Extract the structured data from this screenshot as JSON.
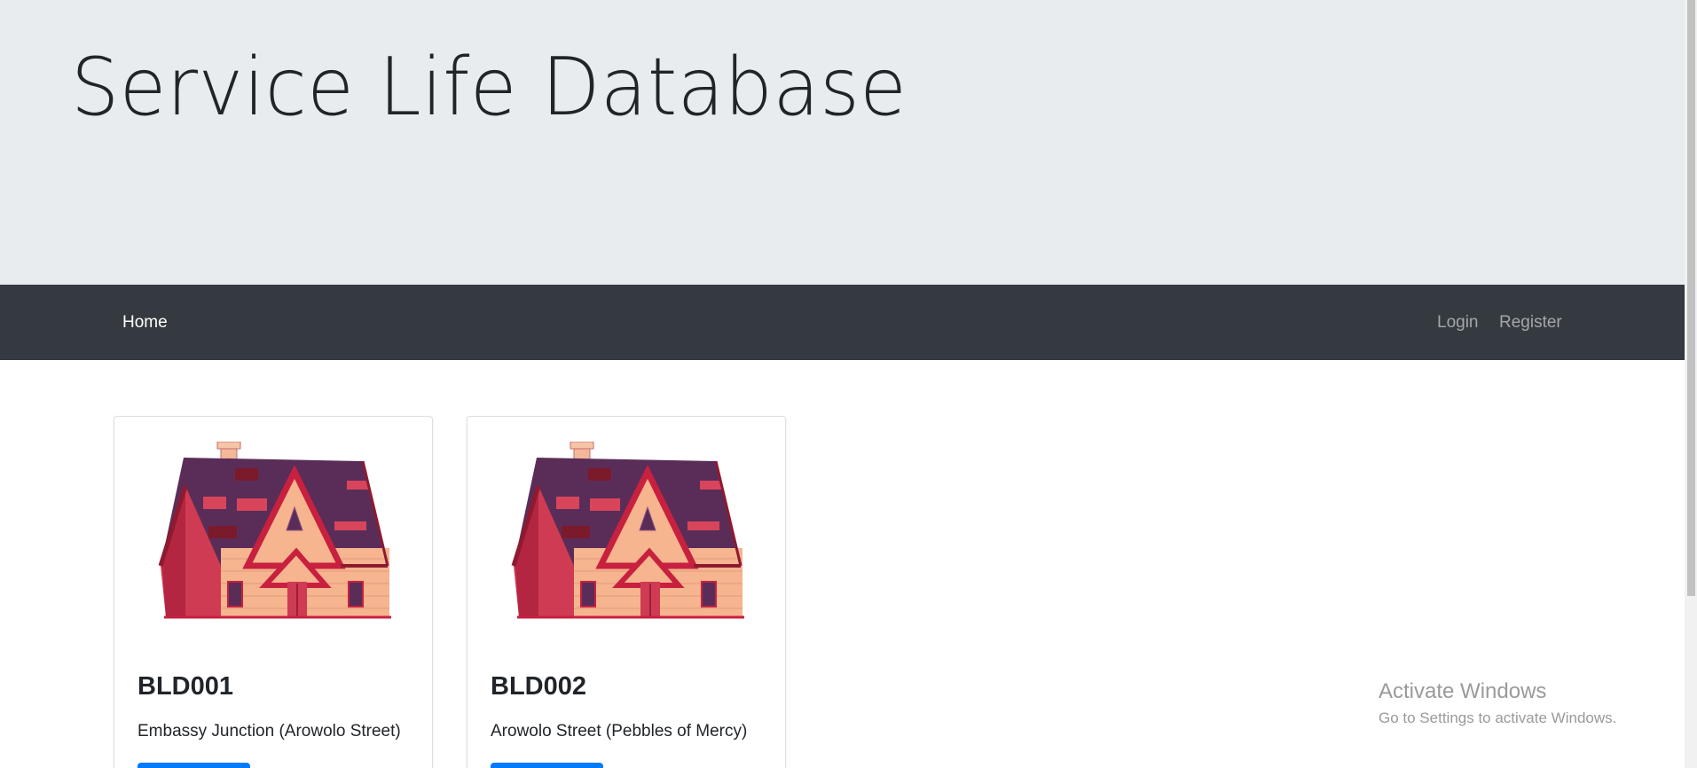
{
  "header": {
    "title": "Service Life Database"
  },
  "nav": {
    "home": "Home",
    "login": "Login",
    "register": "Register"
  },
  "cards": [
    {
      "id": "BLD001",
      "location": "Embassy Junction (Arowolo Street)",
      "image_icon": "house-illustration"
    },
    {
      "id": "BLD002",
      "location": "Arowolo Street (Pebbles of Mercy)",
      "image_icon": "house-illustration"
    }
  ],
  "watermark": {
    "title": "Activate Windows",
    "subtitle": "Go to Settings to activate Windows."
  },
  "colors": {
    "jumbotron_bg": "#e9ecef",
    "navbar_bg": "#343a40",
    "primary": "#007bff",
    "house_roof": "#5a2d58",
    "house_wall_side": "#cf3b52",
    "house_wall_front": "#f6b48f"
  }
}
